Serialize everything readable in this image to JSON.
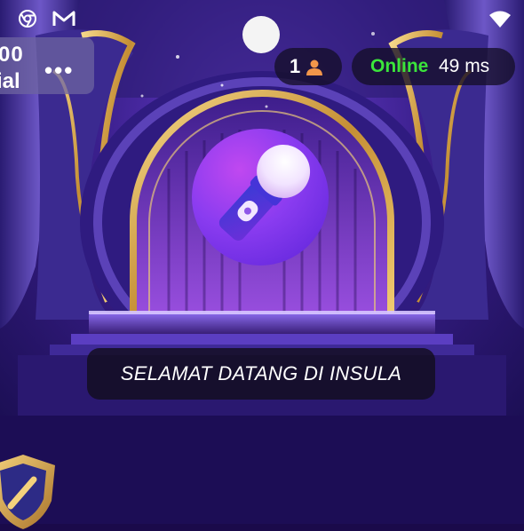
{
  "status_bar": {
    "icons": [
      "chrome-icon",
      "gmail-icon",
      "wifi-icon"
    ]
  },
  "room_card": {
    "line1": "00",
    "line2": "ial",
    "more": "•••"
  },
  "header": {
    "user_count": "1",
    "online_label": "Online",
    "ping": "49 ms"
  },
  "stage": {
    "welcome_text": "SELAMAT DATANG DI INSULA",
    "center_icon": "microphone-icon"
  },
  "colors": {
    "online": "#3be53b",
    "stage_purple": "#3a1f8c",
    "bottom_bg": "#1c0d55",
    "gold": "#d7a84a"
  }
}
